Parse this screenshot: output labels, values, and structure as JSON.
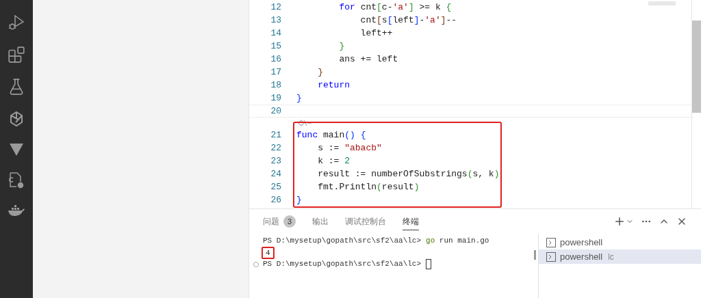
{
  "activity_bar": {
    "items": [
      {
        "kind": "run-debug"
      },
      {
        "kind": "extensions"
      },
      {
        "kind": "testing"
      },
      {
        "kind": "plugin"
      },
      {
        "kind": "funnel"
      },
      {
        "kind": "cpp-config"
      },
      {
        "kind": "docker"
      }
    ]
  },
  "editor": {
    "sections": [
      {
        "highlighted": false,
        "codelens": false,
        "lines": [
          {
            "number": "12",
            "current": false,
            "tokens": [
              {
                "text": "        for",
                "kind": "keyword"
              },
              {
                "text": " cnt",
                "kind": "plain"
              },
              {
                "text": "[",
                "kind": "bracket2"
              },
              {
                "text": "c-",
                "kind": "plain"
              },
              {
                "text": "'a'",
                "kind": "string"
              },
              {
                "text": "]",
                "kind": "bracket2"
              },
              {
                "text": " >= k ",
                "kind": "plain"
              },
              {
                "text": "{",
                "kind": "bracket2"
              }
            ]
          },
          {
            "number": "13",
            "current": false,
            "tokens": [
              {
                "text": "            cnt",
                "kind": "plain"
              },
              {
                "text": "[",
                "kind": "bracket3"
              },
              {
                "text": "s",
                "kind": "plain"
              },
              {
                "text": "[",
                "kind": "bracket1"
              },
              {
                "text": "left",
                "kind": "plain"
              },
              {
                "text": "]",
                "kind": "bracket1"
              },
              {
                "text": "-",
                "kind": "plain"
              },
              {
                "text": "'a'",
                "kind": "string"
              },
              {
                "text": "]",
                "kind": "bracket3"
              },
              {
                "text": "--",
                "kind": "plain"
              }
            ]
          },
          {
            "number": "14",
            "current": false,
            "tokens": [
              {
                "text": "            left++",
                "kind": "plain"
              }
            ]
          },
          {
            "number": "15",
            "current": false,
            "tokens": [
              {
                "text": "        }",
                "kind": "bracket2"
              }
            ]
          },
          {
            "number": "16",
            "current": false,
            "tokens": [
              {
                "text": "        ans += left",
                "kind": "plain"
              }
            ]
          },
          {
            "number": "17",
            "current": false,
            "tokens": [
              {
                "text": "    }",
                "kind": "bracket3"
              }
            ]
          },
          {
            "number": "18",
            "current": false,
            "tokens": [
              {
                "text": "    return",
                "kind": "keyword"
              }
            ]
          },
          {
            "number": "19",
            "current": false,
            "tokens": [
              {
                "text": "}",
                "kind": "bracket1"
              }
            ]
          },
          {
            "number": "20",
            "current": true
          }
        ]
      },
      {
        "highlighted": true,
        "codelens": true,
        "lines": [
          {
            "number": "21",
            "current": false,
            "tokens": [
              {
                "text": "func",
                "kind": "keyword"
              },
              {
                "text": " main",
                "kind": "plain"
              },
              {
                "text": "()",
                "kind": "bracket1"
              },
              {
                "text": " {",
                "kind": "bracket1"
              }
            ]
          },
          {
            "number": "22",
            "current": false,
            "tokens": [
              {
                "text": "    s := ",
                "kind": "plain"
              },
              {
                "text": "\"abacb\"",
                "kind": "string"
              }
            ]
          },
          {
            "number": "23",
            "current": false,
            "tokens": [
              {
                "text": "    k := ",
                "kind": "plain"
              },
              {
                "text": "2",
                "kind": "number"
              }
            ]
          },
          {
            "number": "24",
            "current": false,
            "tokens": [
              {
                "text": "    result := numberOfSubstrings",
                "kind": "plain"
              },
              {
                "text": "(",
                "kind": "bracket2"
              },
              {
                "text": "s, k",
                "kind": "plain"
              },
              {
                "text": ")",
                "kind": "bracket2"
              }
            ]
          },
          {
            "number": "25",
            "current": false,
            "tokens": [
              {
                "text": "    fmt.Println",
                "kind": "plain"
              },
              {
                "text": "(",
                "kind": "bracket2"
              },
              {
                "text": "result",
                "kind": "plain"
              },
              {
                "text": ")",
                "kind": "bracket2"
              }
            ]
          },
          {
            "number": "26",
            "current": false,
            "tokens": [
              {
                "text": "}",
                "kind": "bracket1"
              }
            ]
          }
        ]
      }
    ]
  },
  "panel": {
    "tabs": [
      {
        "label": "问题",
        "badge": "3",
        "selected": false
      },
      {
        "label": "输出",
        "selected": false
      },
      {
        "label": "调试控制台",
        "selected": false
      },
      {
        "label": "终端",
        "selected": true
      }
    ],
    "terminal": {
      "lines": [
        {
          "kind": "prompt",
          "prompt": "PS D:\\mysetup\\gopath\\src\\sf2\\aa\\lc>",
          "command": "go",
          "args": "run main.go",
          "cursor": false,
          "marker": false
        },
        {
          "kind": "output",
          "text": "4",
          "highlighted": true
        },
        {
          "kind": "prompt",
          "prompt": "PS D:\\mysetup\\gopath\\src\\sf2\\aa\\lc>",
          "cursor": true,
          "marker": true
        }
      ]
    },
    "terminals": [
      {
        "name": "powershell",
        "selected": false
      },
      {
        "name": "powershell",
        "suffix": "lc",
        "selected": true
      }
    ]
  }
}
